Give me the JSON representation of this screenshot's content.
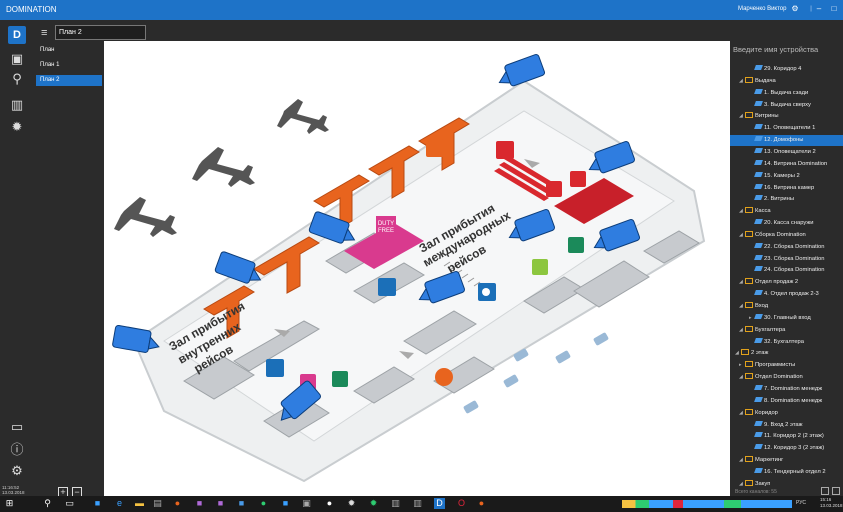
{
  "titlebar": {
    "app_name": "DOMINATION",
    "user": "Марченко Виктор",
    "menu_sep": "|"
  },
  "rail": {
    "logo": "D",
    "date": "11:16:52\n13.03.2018"
  },
  "planlist": {
    "search_value": "План 2",
    "items": [
      {
        "label": "План"
      },
      {
        "label": "План 1"
      },
      {
        "label": "План 2",
        "selected": true
      }
    ],
    "add_label": "+",
    "remove_label": "−"
  },
  "map": {
    "domestic_label": [
      "Зал прибытия",
      "внутренних",
      "рейсов"
    ],
    "international_label": [
      "Зал прибытия",
      "международных",
      "рейсов"
    ],
    "duty_free": [
      "DUTY",
      "FREE"
    ]
  },
  "tree": {
    "search_placeholder": "Введите имя устройства",
    "footer": "Всего каналов: 55",
    "nodes": [
      {
        "label": "29. Коридор 4",
        "type": "cam",
        "level": 3
      },
      {
        "label": "Выдача",
        "type": "folder",
        "level": 2
      },
      {
        "label": "1. Выдача сзади",
        "type": "cam",
        "level": 3
      },
      {
        "label": "3. Выдача сверху",
        "type": "cam",
        "level": 3
      },
      {
        "label": "Витрины",
        "type": "folder",
        "level": 2
      },
      {
        "label": "11. Оповещатели 1",
        "type": "cam",
        "level": 3
      },
      {
        "label": "12. Домофоны",
        "type": "cam",
        "level": 3,
        "selected": true
      },
      {
        "label": "13. Оповещатели 2",
        "type": "cam",
        "level": 3
      },
      {
        "label": "14. Витрина Domination",
        "type": "cam",
        "level": 3
      },
      {
        "label": "15. Камеры 2",
        "type": "cam",
        "level": 3
      },
      {
        "label": "16. Витрина камер",
        "type": "cam",
        "level": 3
      },
      {
        "label": "2. Витрины",
        "type": "cam",
        "level": 3
      },
      {
        "label": "Касса",
        "type": "folder",
        "level": 2
      },
      {
        "label": "20. Касса снаружи",
        "type": "cam",
        "level": 3
      },
      {
        "label": "Сборка Domination",
        "type": "folder",
        "level": 2
      },
      {
        "label": "22. Сборка Domination",
        "type": "cam",
        "level": 3
      },
      {
        "label": "23. Сборка Domination",
        "type": "cam",
        "level": 3
      },
      {
        "label": "24. Сборка Domination",
        "type": "cam",
        "level": 3
      },
      {
        "label": "Отдел продаж 2",
        "type": "folder",
        "level": 2
      },
      {
        "label": "4. Отдел продаж 2-3",
        "type": "cam",
        "level": 3
      },
      {
        "label": "Вход",
        "type": "folder",
        "level": 2
      },
      {
        "label": "30. Главный вход",
        "type": "cam",
        "level": 3,
        "collapsed": true
      },
      {
        "label": "Бухгалтера",
        "type": "folder",
        "level": 2
      },
      {
        "label": "32. Бухгалтера",
        "type": "cam",
        "level": 3
      },
      {
        "label": "2 этаж",
        "type": "folder",
        "level": 1
      },
      {
        "label": "Программисты",
        "type": "folder",
        "level": 2,
        "collapsed": true
      },
      {
        "label": "Отдел Domination",
        "type": "folder",
        "level": 2
      },
      {
        "label": "7. Domination менедж",
        "type": "cam",
        "level": 3
      },
      {
        "label": "8. Domination менедж",
        "type": "cam",
        "level": 3
      },
      {
        "label": "Коридор",
        "type": "folder",
        "level": 2
      },
      {
        "label": "9. Вход 2 этаж",
        "type": "cam",
        "level": 3
      },
      {
        "label": "11. Коридор 2 (2 этаж)",
        "type": "cam",
        "level": 3
      },
      {
        "label": "12. Коридор 3 (2 этаж)",
        "type": "cam",
        "level": 3
      },
      {
        "label": "Маркетинг",
        "type": "folder",
        "level": 2
      },
      {
        "label": "16. Тендерный отдел 2",
        "type": "cam",
        "level": 3
      },
      {
        "label": "Закуп",
        "type": "folder",
        "level": 2
      }
    ]
  },
  "taskbar": {
    "lang": "РУС",
    "time": "15:16",
    "date": "13.03.2018"
  },
  "colors": {
    "accent": "#1e73c8",
    "camera": "#2f7de0",
    "orange": "#e8641e",
    "red": "#d9282e"
  }
}
